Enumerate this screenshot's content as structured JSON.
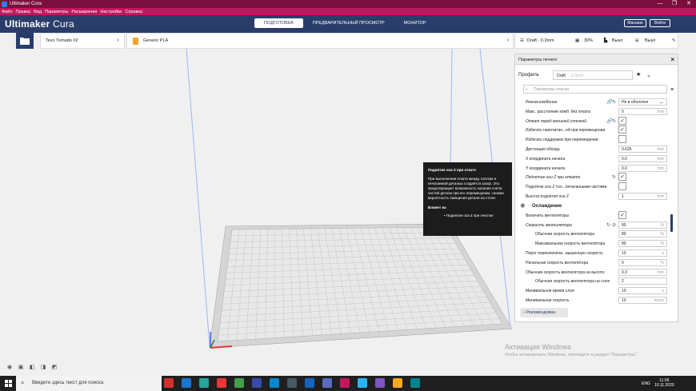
{
  "window": {
    "title": "Ultimaker Cura",
    "controls": [
      "—",
      "❐",
      "✕"
    ]
  },
  "menu": [
    "Файл",
    "Правка",
    "Вид",
    "Параметры",
    "Расширения",
    "Настройки",
    "Справка"
  ],
  "header": {
    "brand_bold": "Ultimaker",
    "brand_light": " Cura",
    "tabs": [
      "ПОДГОТОВКА",
      "ПРЕДВАРИТЕЛЬНЫЙ ПРОСМОТР",
      "МОНИТОР"
    ],
    "active_tab": 0,
    "market": "Магазин",
    "login": "Войти"
  },
  "machine": {
    "name": "Tevo Tornado #2"
  },
  "material": {
    "name": "Generic PLA"
  },
  "print_settings": {
    "profile": "Draft - 0.3mm",
    "infill": "30%",
    "support": "Выкл",
    "adhesion": "Выкл"
  },
  "panel": {
    "title": "Параметры печати",
    "profile_label": "Профиль",
    "profile_value": "Draft",
    "profile_sub": "- 0.3mm",
    "search_placeholder": "Параметры поиска",
    "recommended": "Рекомендован"
  },
  "settings": [
    {
      "name": "Режим комбинга",
      "italic": true,
      "type": "dropdown",
      "value": "Не в оболочке",
      "icons": [
        "🔗",
        "↻"
      ]
    },
    {
      "name": "Макс. расстояние комб. без отката",
      "type": "number",
      "value": "0",
      "unit": "mm"
    },
    {
      "name": "Откат перед внешней стенкой",
      "italic": true,
      "type": "check",
      "checked": true,
      "icons": [
        "🔗",
        "↻"
      ]
    },
    {
      "name": "Избегать напечатан...ей при перемещении",
      "type": "check",
      "checked": true
    },
    {
      "name": "Избегать поддержек при перемещении",
      "type": "check",
      "checked": false
    },
    {
      "name": "Дистанция обхода",
      "type": "number",
      "value": "0.625",
      "unit": "mm"
    },
    {
      "name": "X координата начала",
      "type": "number",
      "value": "0.0",
      "unit": "mm"
    },
    {
      "name": "Y координата начала",
      "type": "number",
      "value": "0.0",
      "unit": "mm"
    },
    {
      "name": "Поднятие оси Z при откате",
      "italic": true,
      "type": "check",
      "checked": true,
      "icons": [
        "↻"
      ]
    },
    {
      "name": "Поднятие оси Z тол...печатанными частями",
      "type": "check",
      "checked": false
    },
    {
      "name": "Высота поднятия оси Z",
      "type": "number",
      "value": "1",
      "unit": "mm"
    },
    {
      "category": true,
      "name": "Охлаждение",
      "icon": "❄"
    },
    {
      "name": "Включить вентиляторы",
      "type": "check",
      "checked": true
    },
    {
      "name": "Скорость вентилятора",
      "italic": true,
      "type": "number",
      "value": "80",
      "unit": "%",
      "icons": [
        "↻",
        "⊘"
      ]
    },
    {
      "name": "Обычная скорость вентилятора",
      "indent": true,
      "type": "number",
      "value": "80",
      "unit": "%"
    },
    {
      "name": "Максимальная скорость вентилятора",
      "indent": true,
      "type": "number",
      "value": "80",
      "unit": "%"
    },
    {
      "name": "Порог переключени...вышенную скорость",
      "type": "number",
      "value": "10",
      "unit": "s"
    },
    {
      "name": "Начальная скорость вентилятора",
      "type": "number",
      "value": "0",
      "unit": "%"
    },
    {
      "name": "Обычная скорость вентилятора на высоте",
      "type": "number",
      "value": "0.3",
      "unit": "mm"
    },
    {
      "name": "Обычная скорость вентилятора на слое",
      "indent": true,
      "type": "number",
      "value": "2",
      "unit": ""
    },
    {
      "name": "Минимальное время слоя",
      "type": "number",
      "value": "10",
      "unit": "s"
    },
    {
      "name": "Минимальная скорость",
      "type": "number",
      "value": "10",
      "unit": "mm/s"
    }
  ],
  "tooltip": {
    "title": "Поднятие оси Z при откате",
    "body": "При выполнении отката между соплом и печатаемой деталью создаётся зазор. Это предотвращает возможность касания сопла частей детали при его перемещении, снижая вероятность смещения детали на столе.",
    "affects_label": "Влияет на",
    "affects_item": "• Поднятие оси Z при очистке"
  },
  "watermark": {
    "line1": "Активация Windows",
    "line2": "Чтобы активировать Windows, перейдите в раздел \"Параметры\"."
  },
  "taskbar": {
    "search_placeholder": "Введите здесь текст для поиска",
    "lang": "ENG",
    "time": "11:06",
    "date": "10.11.2020",
    "app_colors": [
      "#d32f2f",
      "#1976d2",
      "#26a69a",
      "#e53935",
      "#43a047",
      "#3949ab",
      "#0288d1",
      "#455a64",
      "#1565c0",
      "#5c6bc0",
      "#c2185b",
      "#29b6f6",
      "#7e57c2",
      "#f9a825",
      "#00838f"
    ]
  }
}
